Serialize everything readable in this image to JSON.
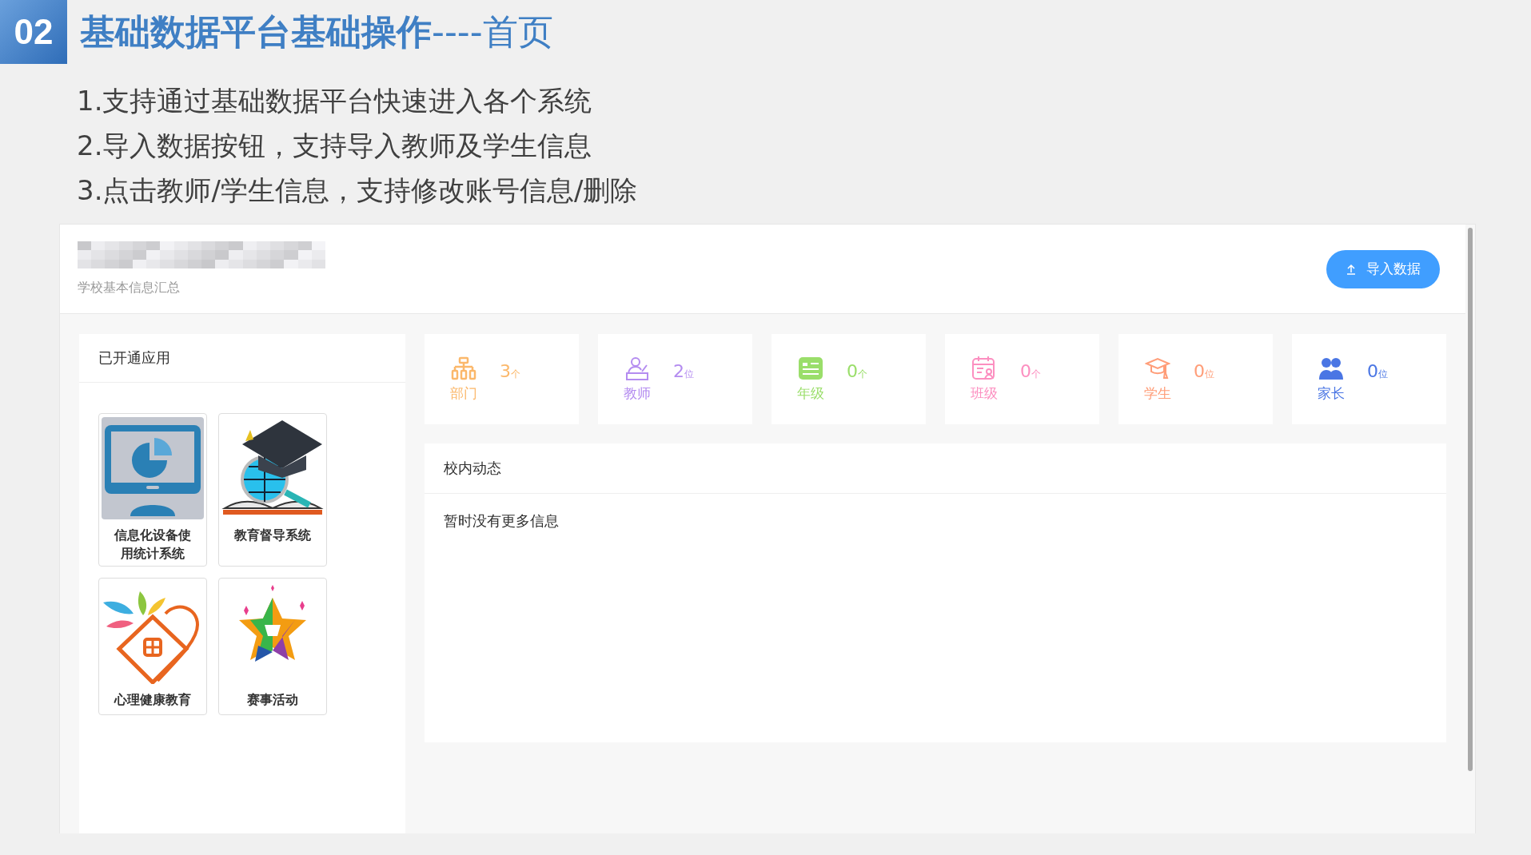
{
  "slide": {
    "number": "02",
    "title": "**基础数据平台基础操作**----首页",
    "bullets": [
      "1.支持通过基础数据平台快速进入各个系统",
      "2.导入数据按钮，支持导入教师及学生信息",
      "3.点击教师/学生信息，支持修改账号信息/删除"
    ]
  },
  "app": {
    "subtitle": "学校基本信息汇总",
    "import_button": "导入数据",
    "apps_panel": {
      "title": "已开通应用",
      "apps": [
        {
          "name": "信息化设备使用统计系统"
        },
        {
          "name": "教育督导系统"
        },
        {
          "name": "心理健康教育"
        },
        {
          "name": "赛事活动"
        }
      ]
    },
    "stats": [
      {
        "label": "部门",
        "value": "3",
        "unit": "个",
        "color": "#fbb86b"
      },
      {
        "label": "教师",
        "value": "2",
        "unit": "位",
        "color": "#b48cf0"
      },
      {
        "label": "年级",
        "value": "0",
        "unit": "个",
        "color": "#9ade6a"
      },
      {
        "label": "班级",
        "value": "0",
        "unit": "个",
        "color": "#fc8fc0"
      },
      {
        "label": "学生",
        "value": "0",
        "unit": "位",
        "color": "#ff9d78"
      },
      {
        "label": "家长",
        "value": "0",
        "unit": "位",
        "color": "#4a76e4"
      }
    ],
    "news": {
      "title": "校内动态",
      "empty_text": "暂时没有更多信息"
    }
  }
}
